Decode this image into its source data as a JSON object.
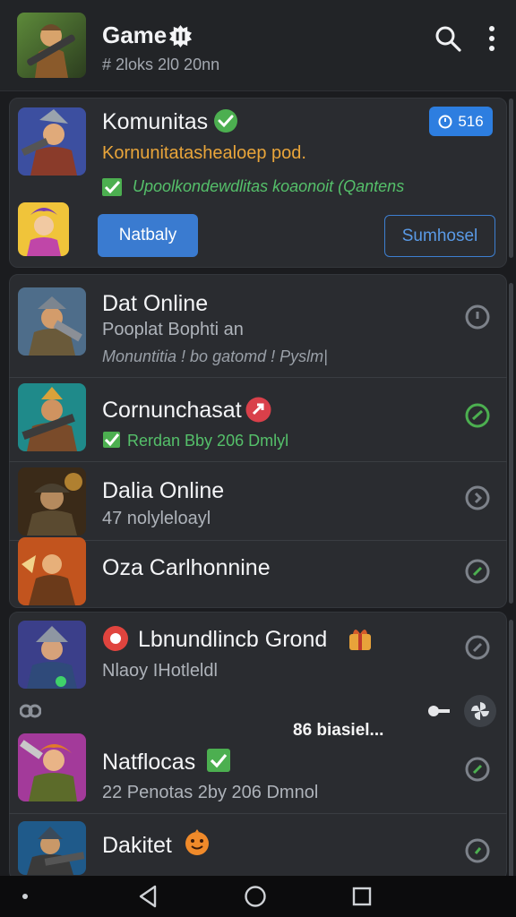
{
  "header": {
    "title": "Game",
    "subtitle": "# 2loks 2l0 20nn",
    "icons": [
      "avatar",
      "settings-badge-icon",
      "search-icon",
      "more-vert-icon"
    ]
  },
  "featured": {
    "title": "Komunitas",
    "badge": "516",
    "line1": "Kornunitatashealoep pod.",
    "line2": "Upoolkondewdlitas koaonoit (Qantens",
    "primary_button": "Natbaly",
    "secondary_button": "Sumhosel"
  },
  "group1": [
    {
      "title": "Dat Online",
      "subtitle": "Pooplat Bophti an",
      "subtitle2": "Monuntitia ! bo gatomd ! Pyslm|"
    },
    {
      "title": "Cornunchasat",
      "subtitle": "Rerdan  Bby 206 Dmlyl"
    },
    {
      "title": "Dalia Online",
      "subtitle": "47 nolyleloayl"
    },
    {
      "title": "Oza  Carlhonnine"
    }
  ],
  "group2": [
    {
      "title": "Lbnundlincb Grond",
      "subtitle": "Nlaoy IHotleldl"
    },
    {
      "title": "Natflocas",
      "subtitle": "22 Penotas 2by 206 Dmnol"
    },
    {
      "title": "Dakitet"
    }
  ],
  "floating": {
    "label": "86 biasiel..."
  },
  "colors": {
    "background": "#1b1c1f",
    "card": "#2a2c30",
    "accent": "#2d7ee0",
    "success": "#4caf50",
    "warning": "#e9a53a"
  }
}
